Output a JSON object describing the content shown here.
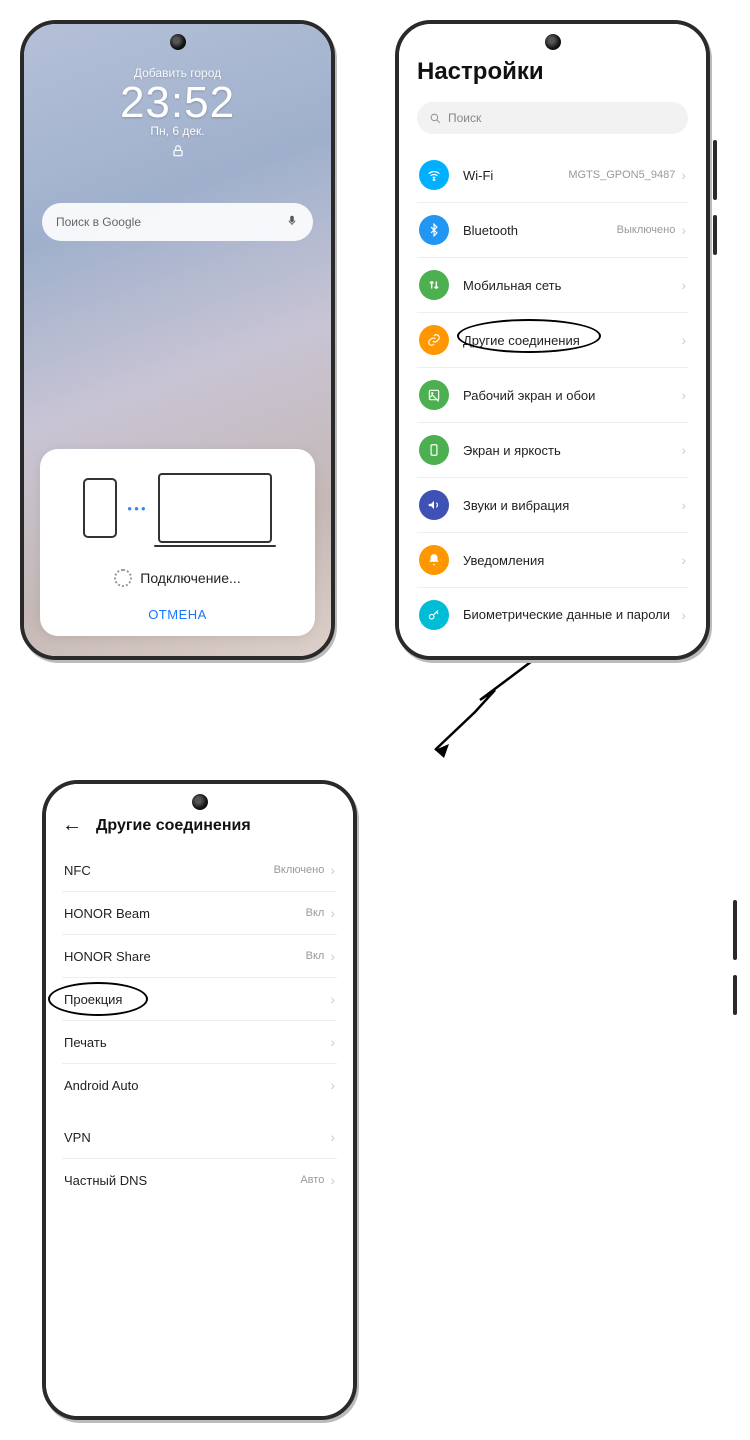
{
  "phone1": {
    "add_city": "Добавить город",
    "time": "23:52",
    "date": "Пн, 6 дек.",
    "search_placeholder": "Поиск в Google",
    "connecting": "Подключение...",
    "cancel": "ОТМЕНА"
  },
  "phone2": {
    "title": "Настройки",
    "search_placeholder": "Поиск",
    "items": [
      {
        "label": "Wi-Fi",
        "value": "MGTS_GPON5_9487"
      },
      {
        "label": "Bluetooth",
        "value": "Выключено"
      },
      {
        "label": "Мобильная сеть",
        "value": ""
      },
      {
        "label": "Другие соединения",
        "value": ""
      },
      {
        "label": "Рабочий экран и обои",
        "value": ""
      },
      {
        "label": "Экран и яркость",
        "value": ""
      },
      {
        "label": "Звуки и вибрация",
        "value": ""
      },
      {
        "label": "Уведомления",
        "value": ""
      },
      {
        "label": "Биометрические данные и пароли",
        "value": ""
      }
    ]
  },
  "phone3": {
    "title": "Другие соединения",
    "groups": [
      [
        {
          "label": "NFC",
          "value": "Включено"
        },
        {
          "label": "HONOR Beam",
          "value": "Вкл"
        },
        {
          "label": "HONOR Share",
          "value": "Вкл"
        },
        {
          "label": "Проекция",
          "value": ""
        },
        {
          "label": "Печать",
          "value": ""
        },
        {
          "label": "Android Auto",
          "value": ""
        }
      ],
      [
        {
          "label": "VPN",
          "value": ""
        },
        {
          "label": "Частный DNS",
          "value": "Авто"
        }
      ]
    ]
  }
}
